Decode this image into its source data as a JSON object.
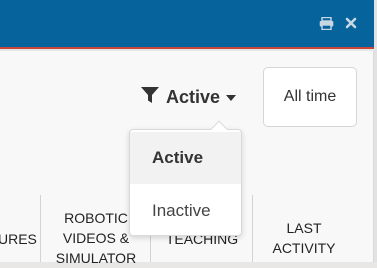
{
  "header": {
    "print_icon": "print-icon",
    "close_icon": "close-icon"
  },
  "filter": {
    "selected_label": "Active",
    "options": [
      {
        "label": "Active"
      },
      {
        "label": "Inactive"
      }
    ]
  },
  "time_range": {
    "label": "All time"
  },
  "columns": [
    {
      "label": "URES"
    },
    {
      "label_lines": [
        "ROBOTIC",
        "VIDEOS &",
        "SIMULATOR"
      ]
    },
    {
      "label": "TEACHING"
    },
    {
      "label_lines": [
        "LAST",
        "ACTIVITY"
      ]
    }
  ],
  "colors": {
    "header_bg": "#06639b",
    "header_accent": "#c8463a"
  }
}
